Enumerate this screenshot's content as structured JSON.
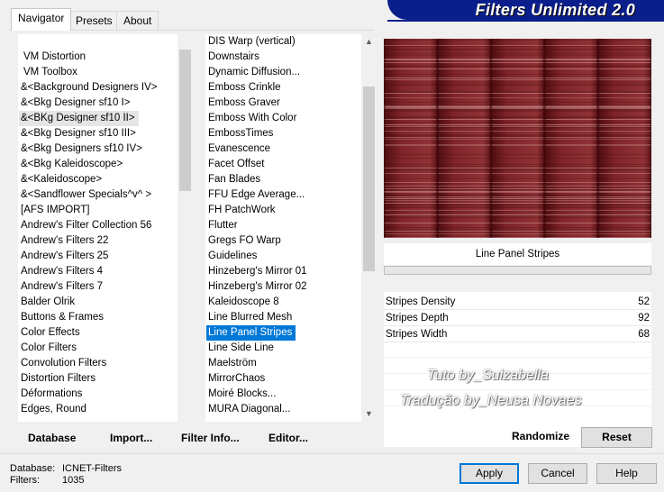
{
  "tabs": [
    "Navigator",
    "Presets",
    "About"
  ],
  "active_tab": 0,
  "header": {
    "title": "Filters Unlimited 2.0"
  },
  "categories": [
    "VM Distortion",
    "VM Toolbox",
    "&<Background Designers IV>",
    "&<Bkg Designer sf10 I>",
    "&<BKg Designer sf10 II>",
    "&<Bkg Designer sf10 III>",
    "&<Bkg Designers sf10 IV>",
    "&<Bkg Kaleidoscope>",
    "&<Kaleidoscope>",
    "&<Sandflower Specials^v^ >",
    "[AFS IMPORT]",
    "Andrew's Filter Collection 56",
    "Andrew's Filters 22",
    "Andrew's Filters 25",
    "Andrew's Filters 4",
    "Andrew's Filters 7",
    "Balder Olrik",
    "Buttons & Frames",
    "Color Effects",
    "Color Filters",
    "Convolution Filters",
    "Distortion Filters",
    "Déformations",
    "Edges, Round"
  ],
  "categories_hover_index": 4,
  "filters": [
    "DIS Warp (vertical)",
    "Downstairs",
    "Dynamic Diffusion...",
    "Emboss Crinkle",
    "Emboss Graver",
    "Emboss With Color",
    "EmbossTimes",
    "Evanescence",
    "Facet Offset",
    "Fan Blades",
    "FFU Edge Average...",
    "FH PatchWork",
    "Flutter",
    "Gregs FO Warp",
    "Guidelines",
    "Hinzeberg's Mirror 01",
    "Hinzeberg's Mirror 02",
    "Kaleidoscope 8",
    "Line Blurred Mesh",
    "Line Panel Stripes",
    "Line Side Line",
    "Maelström",
    "MirrorChaos",
    "Moiré Blocks...",
    "MURA Diagonal..."
  ],
  "filters_selected_index": 19,
  "filters_grip_indices": [
    12,
    14
  ],
  "preview": {
    "filter_name": "Line Panel Stripes"
  },
  "parameters": [
    {
      "name": "Stripes Density",
      "value": "52"
    },
    {
      "name": "Stripes Depth",
      "value": "92"
    },
    {
      "name": "Stripes Width",
      "value": "68"
    }
  ],
  "watermark": {
    "line1": "Tuto by_Suizabella",
    "line2": "Tradução by_Neusa Novaes"
  },
  "actions": {
    "database": "Database",
    "import": "Import...",
    "filter_info": "Filter Info...",
    "editor": "Editor..."
  },
  "buttons": {
    "randomize": "Randomize",
    "reset": "Reset",
    "apply": "Apply",
    "cancel": "Cancel",
    "help": "Help"
  },
  "status": {
    "database_label": "Database:",
    "database_value": "ICNET-Filters",
    "filters_label": "Filters:",
    "filters_value": "1035"
  },
  "colors": {
    "banner": "#0b1f8c",
    "selection": "#0078d7",
    "preview_base": "#7a1a1e"
  }
}
